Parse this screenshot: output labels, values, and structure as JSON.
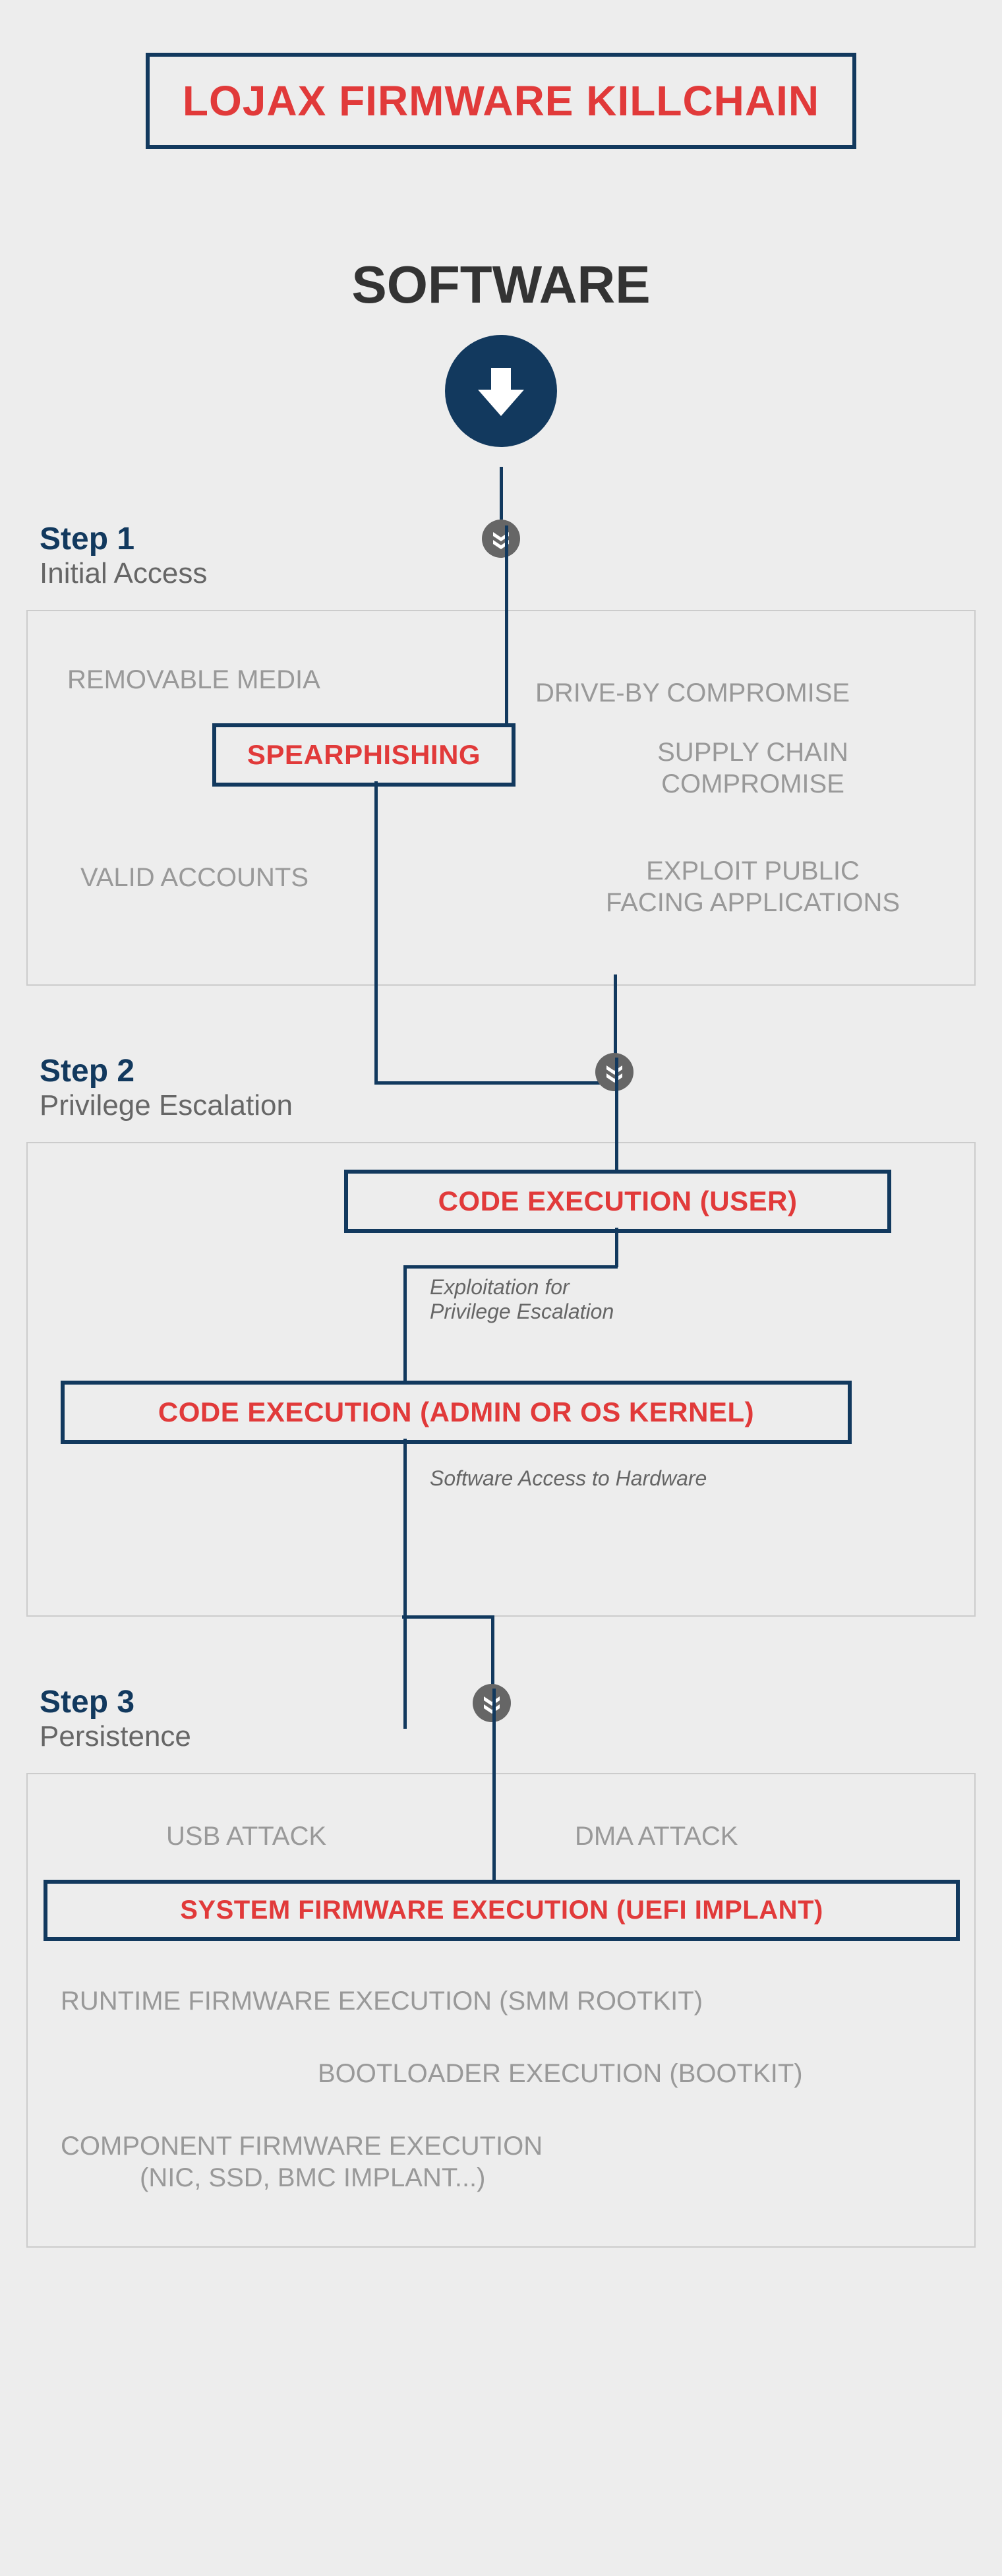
{
  "title": "LOJAX FIRMWARE KILLCHAIN",
  "software": "SOFTWARE",
  "steps": {
    "s1": {
      "num": "Step 1",
      "sub": "Initial Access"
    },
    "s2": {
      "num": "Step 2",
      "sub": "Privilege Escalation"
    },
    "s3": {
      "num": "Step 3",
      "sub": "Persistence"
    }
  },
  "p1": {
    "removable": "REMOVABLE MEDIA",
    "driveby": "DRIVE-BY COMPROMISE",
    "spear": "SPEARPHISHING",
    "supply": "SUPPLY CHAIN COMPROMISE",
    "valid": "VALID ACCOUNTS",
    "exploit": "EXPLOIT PUBLIC FACING APPLICATIONS"
  },
  "p2": {
    "user": "CODE EXECUTION (USER)",
    "note1": "Exploitation for Privilege Escalation",
    "admin": "CODE EXECUTION (ADMIN OR OS KERNEL)",
    "note2": "Software Access to Hardware"
  },
  "p3": {
    "usb": "USB ATTACK",
    "dma": "DMA ATTACK",
    "sys": "SYSTEM FIRMWARE EXECUTION (UEFI IMPLANT)",
    "runtime": "RUNTIME FIRMWARE EXECUTION (SMM ROOTKIT)",
    "boot": "BOOTLOADER EXECUTION (BOOTKIT)",
    "comp": "COMPONENT FIRMWARE EXECUTION (NIC, SSD, BMC IMPLANT...)"
  }
}
